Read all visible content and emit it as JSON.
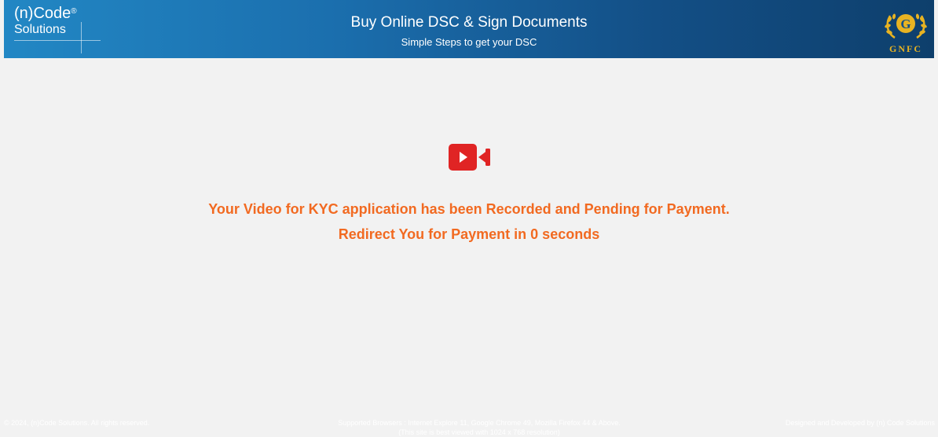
{
  "header": {
    "logo_left": {
      "line1": "(n)Code",
      "registered": "®",
      "line2": "Solutions"
    },
    "title": "Buy Online DSC & Sign Documents",
    "subtitle": "Simple Steps to get your DSC",
    "logo_right": {
      "emblem_letter": "G",
      "text": "GNFC"
    },
    "colors": {
      "gradient_start": "#2287c4",
      "gradient_end": "#0e3f6c",
      "logo_gold": "#e8b322"
    }
  },
  "main": {
    "icon": "video-camera-icon",
    "icon_color": "#e02424",
    "message_line1": "Your Video for KYC application has been Recorded and Pending for Payment.",
    "message_line2": "Redirect You for Payment in 0 seconds",
    "message_color": "#f26a21"
  },
  "footer": {
    "left": "© 2024, (n)Code Solutions. All rights reserved.",
    "center": "Supported Browsers : Internet Explore 11, Google Chrome 49, Mozilla Firefox 44 & Above. (This site is best viewed with 1024 x 768 resolution)",
    "right": "Designed and Developed by (n) Code Solutions"
  }
}
